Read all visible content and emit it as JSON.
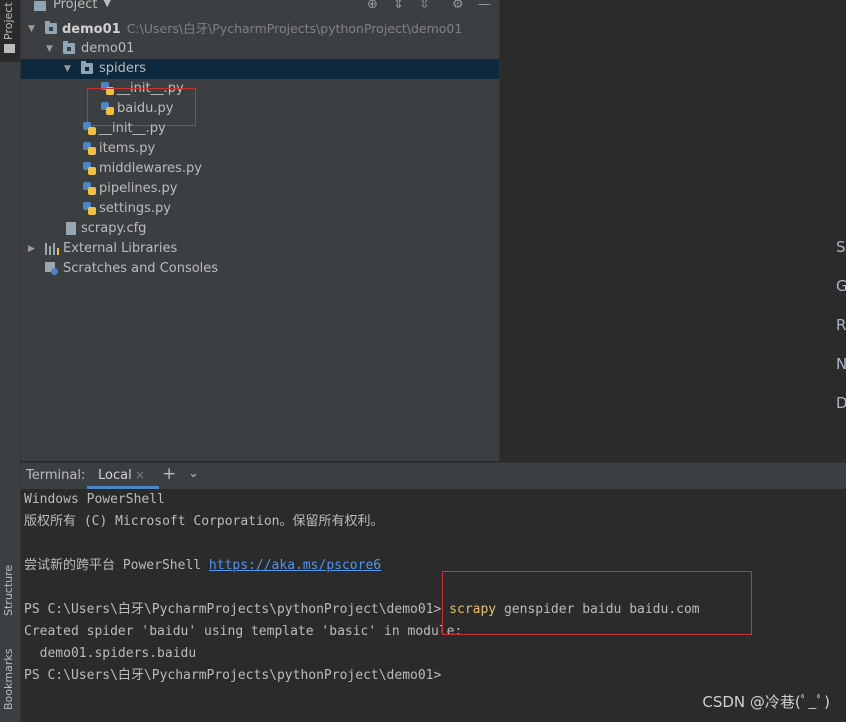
{
  "toolwindow": {
    "project_tab": "Project",
    "structure_tab": "Structure",
    "bookmarks_tab": "Bookmarks"
  },
  "project": {
    "header_title": "Project",
    "root_name": "demo01",
    "root_path": "C:\\Users\\白牙\\PycharmProjects\\pythonProject\\demo01",
    "pkg": "demo01",
    "spiders": "spiders",
    "spider_init": "__init__.py",
    "baidu": "baidu.py",
    "init": "__init__.py",
    "items": "items.py",
    "middlewares": "middlewares.py",
    "pipelines": "pipelines.py",
    "settings": "settings.py",
    "scrapy_cfg": "scrapy.cfg",
    "external_libs": "External Libraries",
    "scratches": "Scratches and Consoles"
  },
  "editor": {
    "partial_chars": [
      "S",
      "G",
      "R",
      "N",
      "D"
    ]
  },
  "terminal": {
    "label": "Terminal:",
    "tab": "Local",
    "line1": "Windows PowerShell",
    "line2": "版权所有 (C) Microsoft Corporation。保留所有权利。",
    "line3_text": "尝试新的跨平台 PowerShell ",
    "line3_link": "https://aka.ms/pscore6",
    "prompt": "PS C:\\Users\\白牙\\PycharmProjects\\pythonProject\\demo01>",
    "cmd_keyword": "scrapy",
    "cmd_args": " genspider baidu baidu.com",
    "out1": "Created spider 'baidu' using template 'basic' in module:",
    "out2": "  demo01.spiders.baidu",
    "prompt2": "PS C:\\Users\\白牙\\PycharmProjects\\pythonProject\\demo01>"
  },
  "watermark": "CSDN @冷巷(ﾟ_ﾟ)"
}
